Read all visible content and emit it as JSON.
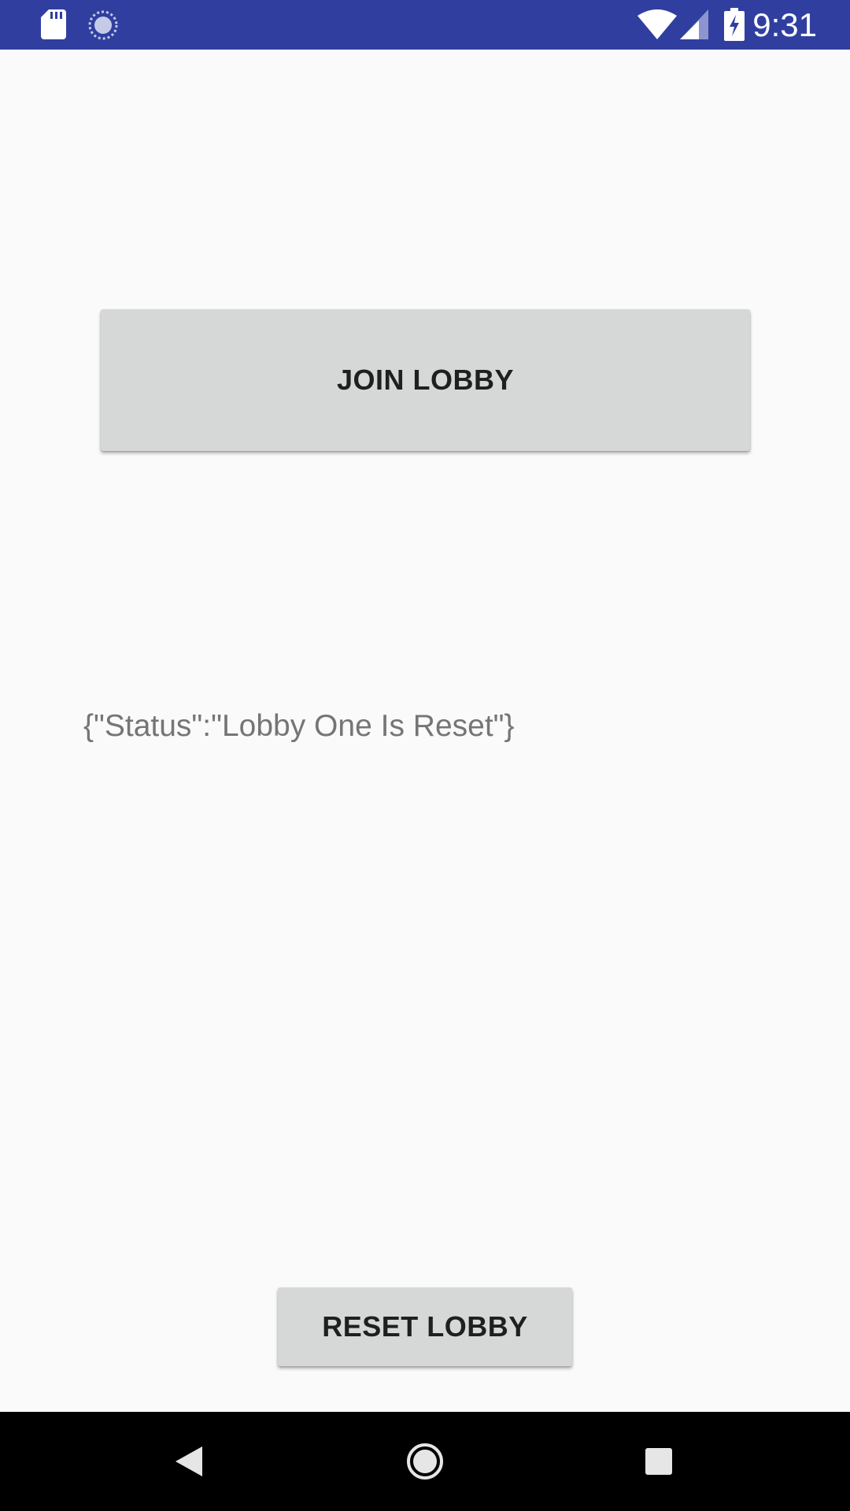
{
  "status_bar": {
    "time": "9:31",
    "icons": [
      "sd-card-icon",
      "sync-icon",
      "wifi-icon",
      "cellular-signal-icon",
      "battery-charging-icon"
    ]
  },
  "main": {
    "join_label": "JOIN LOBBY",
    "status_text": "{\"Status\":\"Lobby One Is Reset\"}",
    "reset_label": "RESET LOBBY"
  },
  "nav_bar": {
    "icons": [
      "back-icon",
      "home-icon",
      "recents-icon"
    ]
  },
  "colors": {
    "status_bar": "#303f9f",
    "background": "#fafafa",
    "button": "#d6d7d7",
    "button_text": "#1f1f1f",
    "status_text": "#757575",
    "nav_bar": "#000000"
  }
}
